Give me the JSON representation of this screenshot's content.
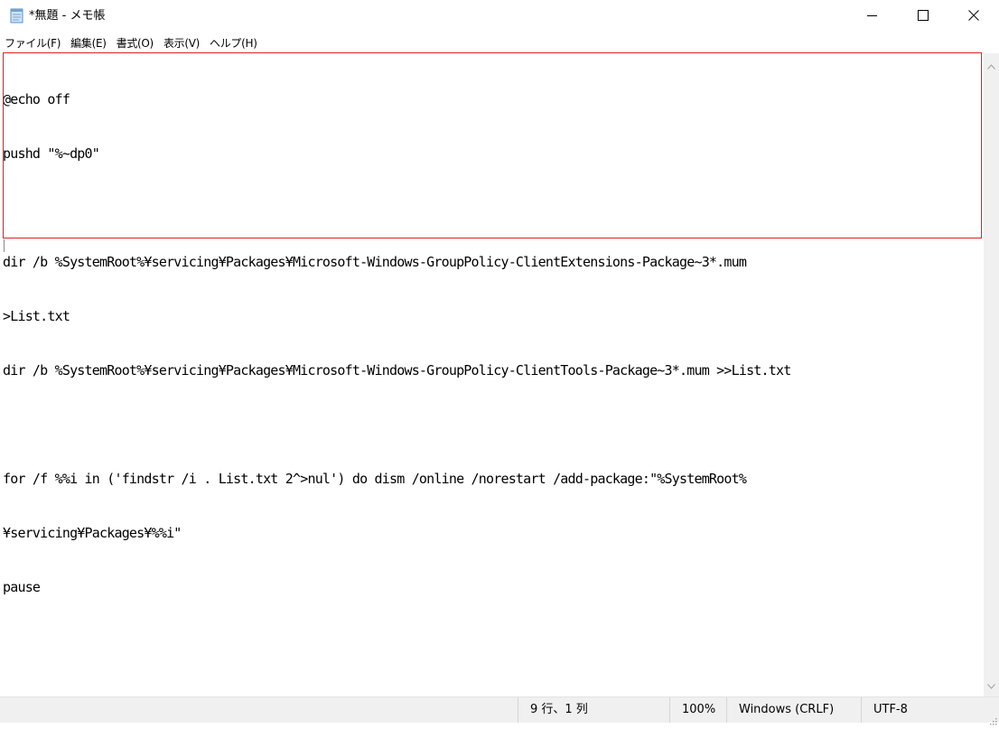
{
  "window": {
    "title": "*無題 - メモ帳",
    "icon": "notepad-icon",
    "minimize_icon": "minimize-icon",
    "maximize_icon": "maximize-icon",
    "close_icon": "close-icon"
  },
  "menu": {
    "items": [
      {
        "label": "ファイル(F)"
      },
      {
        "label": "編集(E)"
      },
      {
        "label": "書式(O)"
      },
      {
        "label": "表示(V)"
      },
      {
        "label": "ヘルプ(H)"
      }
    ]
  },
  "editor": {
    "lines": [
      "@echo off",
      "pushd \"%~dp0\"",
      "",
      "dir /b %SystemRoot%¥servicing¥Packages¥Microsoft-Windows-GroupPolicy-ClientExtensions-Package~3*.mum",
      ">List.txt",
      "dir /b %SystemRoot%¥servicing¥Packages¥Microsoft-Windows-GroupPolicy-ClientTools-Package~3*.mum >>List.txt",
      "",
      "for /f %%i in ('findstr /i . List.txt 2^>nul') do dism /online /norestart /add-package:\"%SystemRoot%",
      "¥servicing¥Packages¥%%i\"",
      "pause"
    ],
    "highlight_color": "#e02020"
  },
  "status": {
    "position": "9 行、1 列",
    "zoom": "100%",
    "line_ending": "Windows (CRLF)",
    "encoding": "UTF-8"
  }
}
